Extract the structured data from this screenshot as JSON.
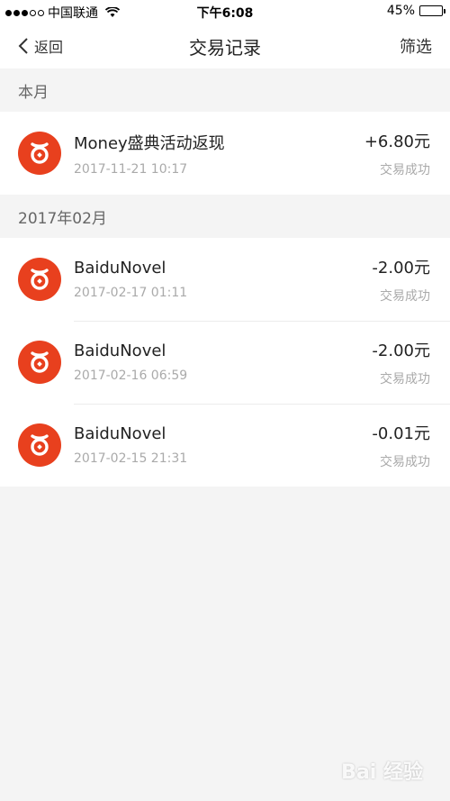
{
  "status_bar": {
    "carrier": "中国联通",
    "time": "下午6:08",
    "battery": "45%",
    "battery_level": 0.45
  },
  "nav": {
    "back_label": "返回",
    "title": "交易记录",
    "filter_label": "筛选"
  },
  "sections": [
    {
      "header": "本月",
      "items": [
        {
          "title": "Money盛典活动返现",
          "time": "2017-11-21 10:17",
          "amount": "+6.80元",
          "status": "交易成功"
        }
      ]
    },
    {
      "header": "2017年02月",
      "items": [
        {
          "title": "BaiduNovel",
          "time": "2017-02-17 01:11",
          "amount": "-2.00元",
          "status": "交易成功"
        },
        {
          "title": "BaiduNovel",
          "time": "2017-02-16 06:59",
          "amount": "-2.00元",
          "status": "交易成功"
        },
        {
          "title": "BaiduNovel",
          "time": "2017-02-15 21:31",
          "amount": "-0.01元",
          "status": "交易成功"
        }
      ]
    }
  ],
  "watermark": "Bai 经验",
  "colors": {
    "app_icon": "#e8401e",
    "background": "#f4f4f4"
  }
}
